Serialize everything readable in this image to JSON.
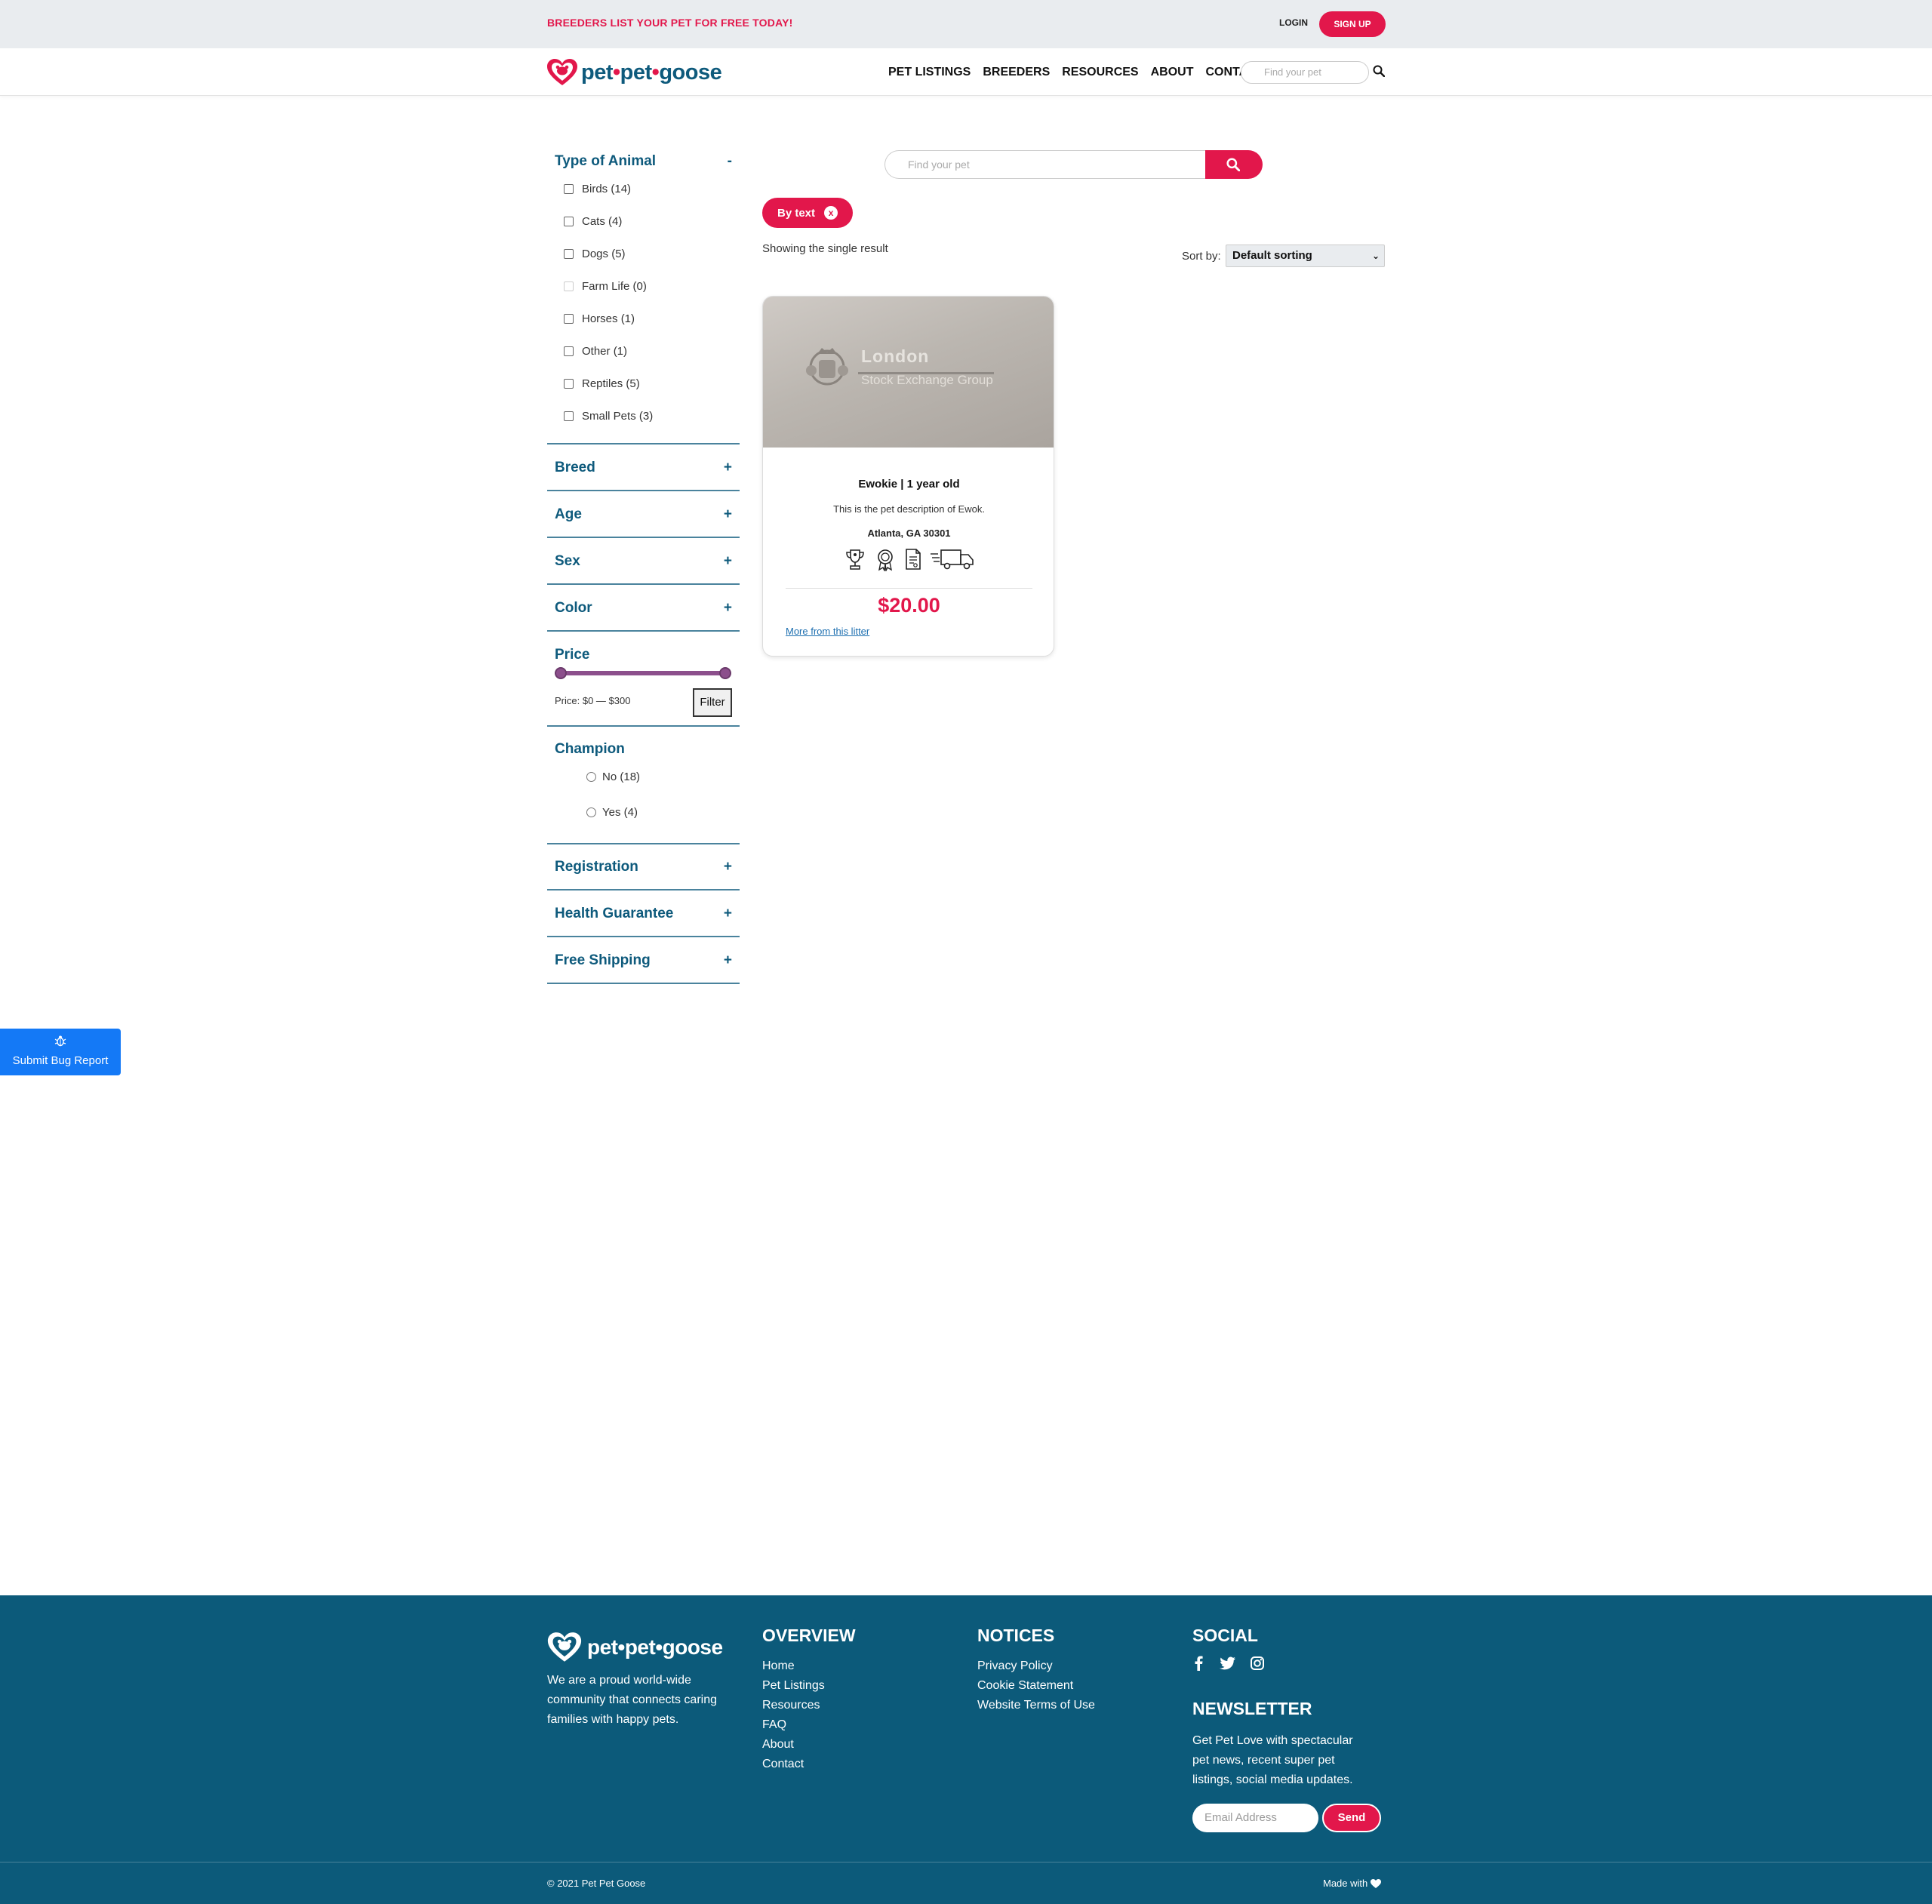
{
  "topbar": {
    "promo": "BREEDERS LIST YOUR PET FOR FREE TODAY!",
    "login": "LOGIN",
    "signup": "SIGN UP"
  },
  "brand": {
    "part1": "pet",
    "part2": "pet",
    "part3": "goose",
    "dot": "•",
    "primary_color": "#0e5a7c",
    "accent_color": "#e2174b"
  },
  "nav": {
    "items": [
      "PET LISTINGS",
      "BREEDERS",
      "RESOURCES",
      "ABOUT",
      "CONTACT"
    ],
    "search_placeholder": "Find your pet"
  },
  "filters": {
    "type_of_animal": {
      "title": "Type of Animal",
      "toggle": "-",
      "options": [
        {
          "label": "Birds",
          "count": "(14)"
        },
        {
          "label": "Cats",
          "count": "(4)"
        },
        {
          "label": "Dogs",
          "count": "(5)"
        },
        {
          "label": "Farm Life",
          "count": "(0)"
        },
        {
          "label": "Horses",
          "count": "(1)"
        },
        {
          "label": "Other",
          "count": "(1)"
        },
        {
          "label": "Reptiles",
          "count": "(5)"
        },
        {
          "label": "Small Pets",
          "count": "(3)"
        }
      ]
    },
    "breed": {
      "title": "Breed",
      "toggle": "+"
    },
    "age": {
      "title": "Age",
      "toggle": "+"
    },
    "sex": {
      "title": "Sex",
      "toggle": "+"
    },
    "color": {
      "title": "Color",
      "toggle": "+"
    },
    "price": {
      "title": "Price",
      "label": "Price: $0 — $300",
      "filter_button": "Filter",
      "min": 0,
      "max": 300,
      "slider_color": "#8c4f8c"
    },
    "champion": {
      "title": "Champion",
      "options": [
        {
          "label": "No",
          "count": "(18)"
        },
        {
          "label": "Yes",
          "count": "(4)"
        }
      ]
    },
    "registration": {
      "title": "Registration",
      "toggle": "+"
    },
    "health_guarantee": {
      "title": "Health Guarantee",
      "toggle": "+"
    },
    "free_shipping": {
      "title": "Free Shipping",
      "toggle": "+"
    }
  },
  "main": {
    "search_placeholder": "Find your pet",
    "chip": {
      "label": "By text",
      "remove": "x"
    },
    "result_count": "Showing the single result",
    "sort_label": "Sort by:",
    "sort_value": "Default sorting"
  },
  "card": {
    "image_text_line1": "London",
    "image_text_line2": "Stock Exchange Group",
    "title": "Ewokie | 1 year old",
    "description": "This is the pet description of Ewok.",
    "location": "Atlanta, GA 30301",
    "icons": [
      "trophy-icon",
      "award-ribbon-icon",
      "document-icon",
      "shipping-truck-icon"
    ],
    "price": "$20.00",
    "litter_link": "More from this litter"
  },
  "bug_report": {
    "label": "Submit Bug Report",
    "color": "#1479f6"
  },
  "footer": {
    "about": "We are a proud world-wide community that connects caring families with happy pets.",
    "overview": {
      "title": "OVERVIEW",
      "links": [
        "Home",
        "Pet Listings",
        "Resources",
        "FAQ",
        "About",
        "Contact"
      ]
    },
    "notices": {
      "title": "NOTICES",
      "links": [
        "Privacy Policy",
        "Cookie Statement",
        "Website Terms of Use"
      ]
    },
    "social": {
      "title": "SOCIAL",
      "icons": [
        "facebook-icon",
        "twitter-icon",
        "instagram-icon"
      ]
    },
    "newsletter": {
      "title": "NEWSLETTER",
      "text": "Get Pet Love with spectacular pet news, recent super pet listings, social media updates.",
      "email_placeholder": "Email Address",
      "send": "Send"
    },
    "copyright": "© 2021 Pet Pet Goose",
    "made_with": "Made with",
    "background": "#0c5a7a"
  }
}
